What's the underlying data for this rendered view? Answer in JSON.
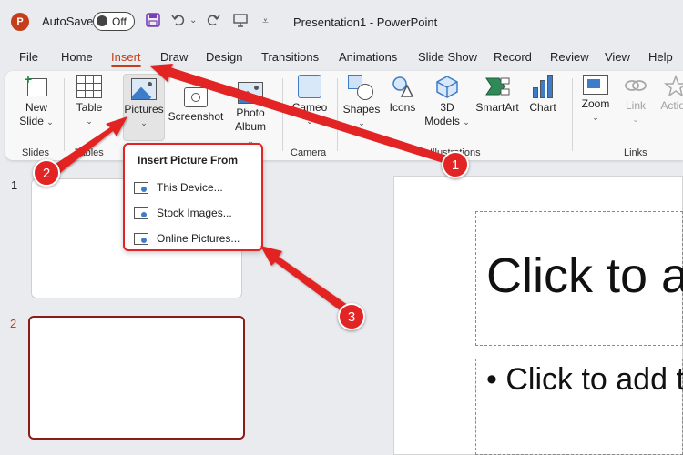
{
  "titlebar": {
    "autosave_label": "AutoSave",
    "autosave_state": "Off",
    "document_title": "Presentation1  -  PowerPoint"
  },
  "tabs": [
    "File",
    "Home",
    "Insert",
    "Draw",
    "Design",
    "Transitions",
    "Animations",
    "Slide Show",
    "Record",
    "Review",
    "View",
    "Help"
  ],
  "active_tab": "Insert",
  "ribbon": {
    "new_slide": "New",
    "new_slide_2": "Slide",
    "table": "Table",
    "pictures": "Pictures",
    "screenshot": "Screenshot",
    "photo_album": "Photo",
    "photo_album_2": "Album",
    "cameo": "Cameo",
    "shapes": "Shapes",
    "icons": "Icons",
    "models_3d": "3D",
    "models_3d_2": "Models",
    "smartart": "SmartArt",
    "chart": "Chart",
    "zoom": "Zoom",
    "link": "Link",
    "action": "Action",
    "groups": {
      "slides": "Slides",
      "tables": "Tables",
      "camera": "Camera",
      "illustrations": "Illustrations",
      "links": "Links"
    }
  },
  "menu": {
    "header": "Insert Picture From",
    "items": [
      "This Device...",
      "Stock Images...",
      "Online Pictures..."
    ]
  },
  "thumbnails": {
    "numbers": [
      "1",
      "2"
    ]
  },
  "slide": {
    "title_placeholder": "Click to add title",
    "body_placeholder": "Click to add text"
  },
  "annotations": [
    "1",
    "2",
    "3"
  ],
  "colors": {
    "accent": "#c43e1c",
    "annotation_red": "#e32424",
    "selected_thumb_border": "#8b1c1c"
  }
}
